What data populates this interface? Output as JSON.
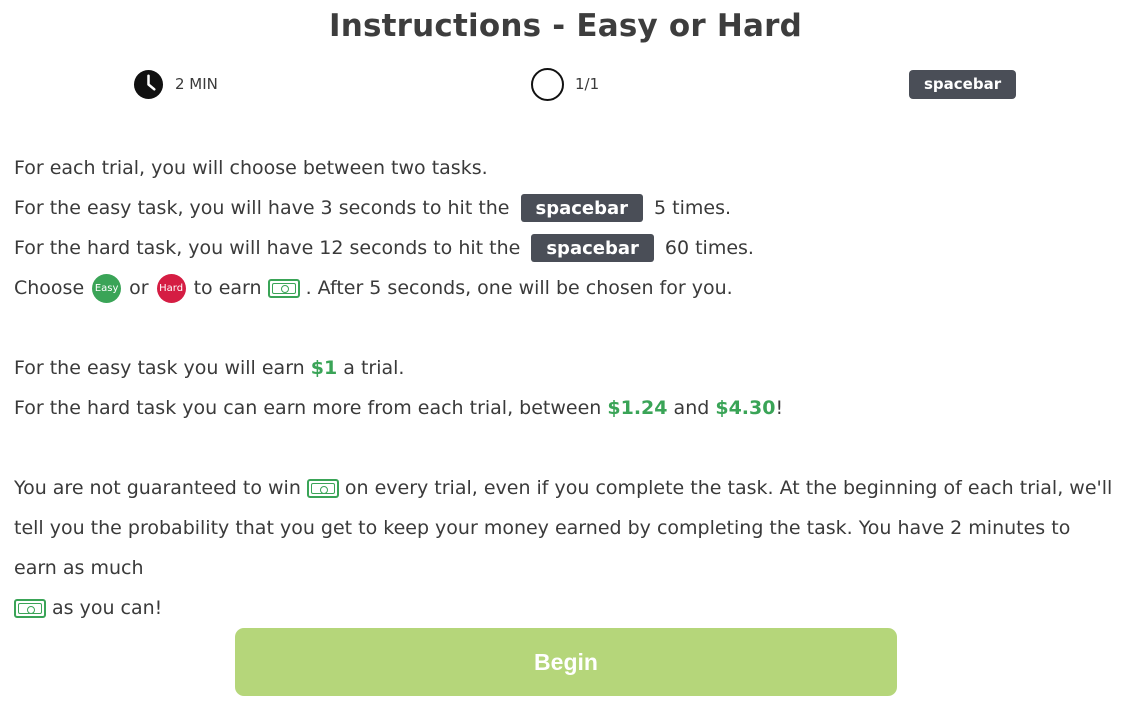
{
  "header": {
    "title": "Instructions - Easy or Hard"
  },
  "status": {
    "timer_text": "2 MIN",
    "progress_text": "1/1",
    "key_label": "spacebar",
    "timer_icon": "clock-icon",
    "progress_icon": "progress-ring-icon"
  },
  "instructions": {
    "line1": "For each trial, you will choose between two tasks.",
    "line2_before": "For the easy task, you will have 3 seconds to hit the",
    "line2_key": "spacebar",
    "line2_after": "5 times.",
    "line3_before": "For the hard task, you will have 12 seconds to hit the",
    "line3_key": "spacebar",
    "line3_after": "60 times.",
    "line4_choose": "Choose",
    "easy_label": "Easy",
    "line4_or": "or",
    "hard_label": "Hard",
    "line4_earn": "to earn",
    "line4_after": ". After 5 seconds, one will be chosen for you.",
    "line5_before": "For the easy task you will earn",
    "easy_amount": "$1",
    "line5_after": "a trial.",
    "line6_before": "For the hard task you can earn more from each trial, between",
    "hard_min": "$1.24",
    "line6_and": "and",
    "hard_max": "$4.30",
    "line6_after": "!",
    "para_part1": "You are not guaranteed to win",
    "para_part2": "on every trial, even if you complete the task. At the beginning of each trial, we'll tell you the probability that you get to keep your money earned by completing the task. You have 2 minutes to earn as much",
    "para_part3": "as you can!"
  },
  "begin_button": {
    "label": "Begin"
  },
  "colors": {
    "easy": "#3aa457",
    "hard": "#d51d43",
    "money": "#3aa457",
    "key_badge": "#4a4e57",
    "begin_button": "#b5d67a"
  },
  "icons": {
    "money": "money-icon"
  }
}
